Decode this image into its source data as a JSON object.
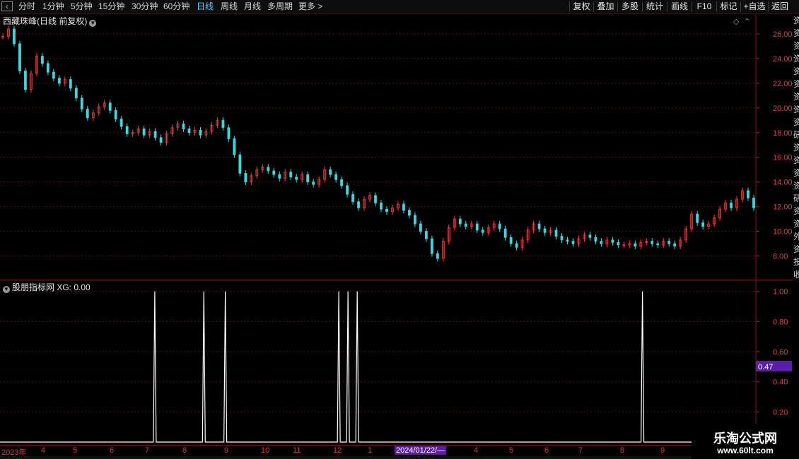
{
  "toolbar": {
    "periods": [
      "分时",
      "1分钟",
      "5分钟",
      "15分钟",
      "30分钟",
      "60分钟",
      "日线",
      "周线",
      "月线",
      "多周期",
      "更多 >"
    ],
    "active_period": "日线",
    "actions": [
      "复权",
      "叠加",
      "多股",
      "统计",
      "画线",
      "F10",
      "标记",
      "+自选",
      "返回"
    ]
  },
  "main_chart": {
    "title": "西藏珠峰(日线 前复权)",
    "y_ticks": [
      "26.00",
      "24.00",
      "22.00",
      "20.00",
      "18.00",
      "16.00",
      "14.00",
      "12.00",
      "10.00",
      "8.00"
    ],
    "up_color": "#ff3b3b",
    "down_color": "#3ad8e0"
  },
  "indicator": {
    "title": "股朋指标网 XG: 0.00",
    "y_ticks": [
      "1.00",
      "0.80",
      "0.60",
      "0.40",
      "0.20"
    ],
    "cursor_value": "0.47",
    "line_color": "#ffffff"
  },
  "date_axis": {
    "labels": [
      "2023年",
      "4",
      "5",
      "6",
      "7",
      "8",
      "9",
      "10",
      "11",
      "12",
      "1",
      "2024/01/22/—",
      "4",
      "5",
      "6",
      "7",
      "8",
      "9"
    ]
  },
  "right_strip": [
    "资",
    "资",
    "资",
    "资",
    "资",
    "资",
    "资",
    "资",
    "资",
    "研",
    "资",
    "资",
    "资",
    "资",
    "研",
    "资",
    "资",
    "外",
    "资",
    "投",
    "收"
  ],
  "watermark": {
    "line1": "乐淘公式网",
    "line2": "www.60lt.com"
  },
  "chart_data": {
    "type": "candlestick",
    "price_series_approx_close": [
      25.8,
      26.4,
      25.2,
      23.0,
      21.5,
      22.8,
      24.2,
      23.6,
      22.9,
      22.4,
      22.0,
      22.3,
      21.6,
      20.8,
      19.9,
      19.2,
      19.6,
      20.1,
      20.4,
      19.8,
      19.1,
      18.5,
      17.9,
      18.0,
      18.3,
      17.8,
      18.1,
      17.6,
      17.2,
      17.9,
      18.4,
      18.7,
      18.3,
      18.0,
      18.2,
      17.8,
      18.1,
      18.6,
      19.0,
      18.4,
      17.5,
      16.2,
      14.7,
      14.0,
      14.5,
      15.0,
      15.2,
      14.9,
      14.6,
      14.3,
      14.8,
      14.4,
      14.2,
      14.6,
      14.0,
      13.8,
      14.2,
      15.0,
      14.6,
      14.2,
      13.7,
      13.0,
      12.4,
      11.9,
      12.6,
      12.9,
      12.3,
      11.8,
      11.6,
      11.9,
      12.2,
      11.7,
      11.3,
      10.6,
      10.0,
      9.4,
      8.2,
      7.8,
      9.2,
      10.3,
      11.0,
      10.6,
      10.4,
      10.6,
      10.1,
      9.9,
      10.3,
      10.6,
      10.2,
      9.5,
      9.0,
      8.7,
      9.3,
      10.1,
      10.6,
      10.2,
      9.9,
      10.1,
      9.6,
      9.3,
      9.2,
      9.0,
      9.4,
      9.7,
      9.5,
      9.2,
      9.0,
      9.3,
      9.1,
      8.9,
      8.9,
      9.0,
      8.8,
      9.1,
      9.2,
      9.0,
      8.9,
      9.2,
      9.0,
      8.8,
      9.3,
      10.2,
      11.4,
      10.7,
      10.4,
      10.6,
      11.1,
      11.8,
      12.3,
      11.9,
      12.6,
      13.3,
      12.7,
      11.9
    ],
    "y_range": [
      7.0,
      26.8
    ],
    "indicator_signals_xg": [
      {
        "date_index": 50,
        "value": 1
      },
      {
        "date_index": 66,
        "value": 1
      },
      {
        "date_index": 73,
        "value": 1
      },
      {
        "date_index": 110,
        "value": 1
      },
      {
        "date_index": 113,
        "value": 1
      },
      {
        "date_index": 116,
        "value": 1
      },
      {
        "date_index": 209,
        "value": 1
      }
    ],
    "indicator_y_range": [
      0,
      1.05
    ]
  }
}
